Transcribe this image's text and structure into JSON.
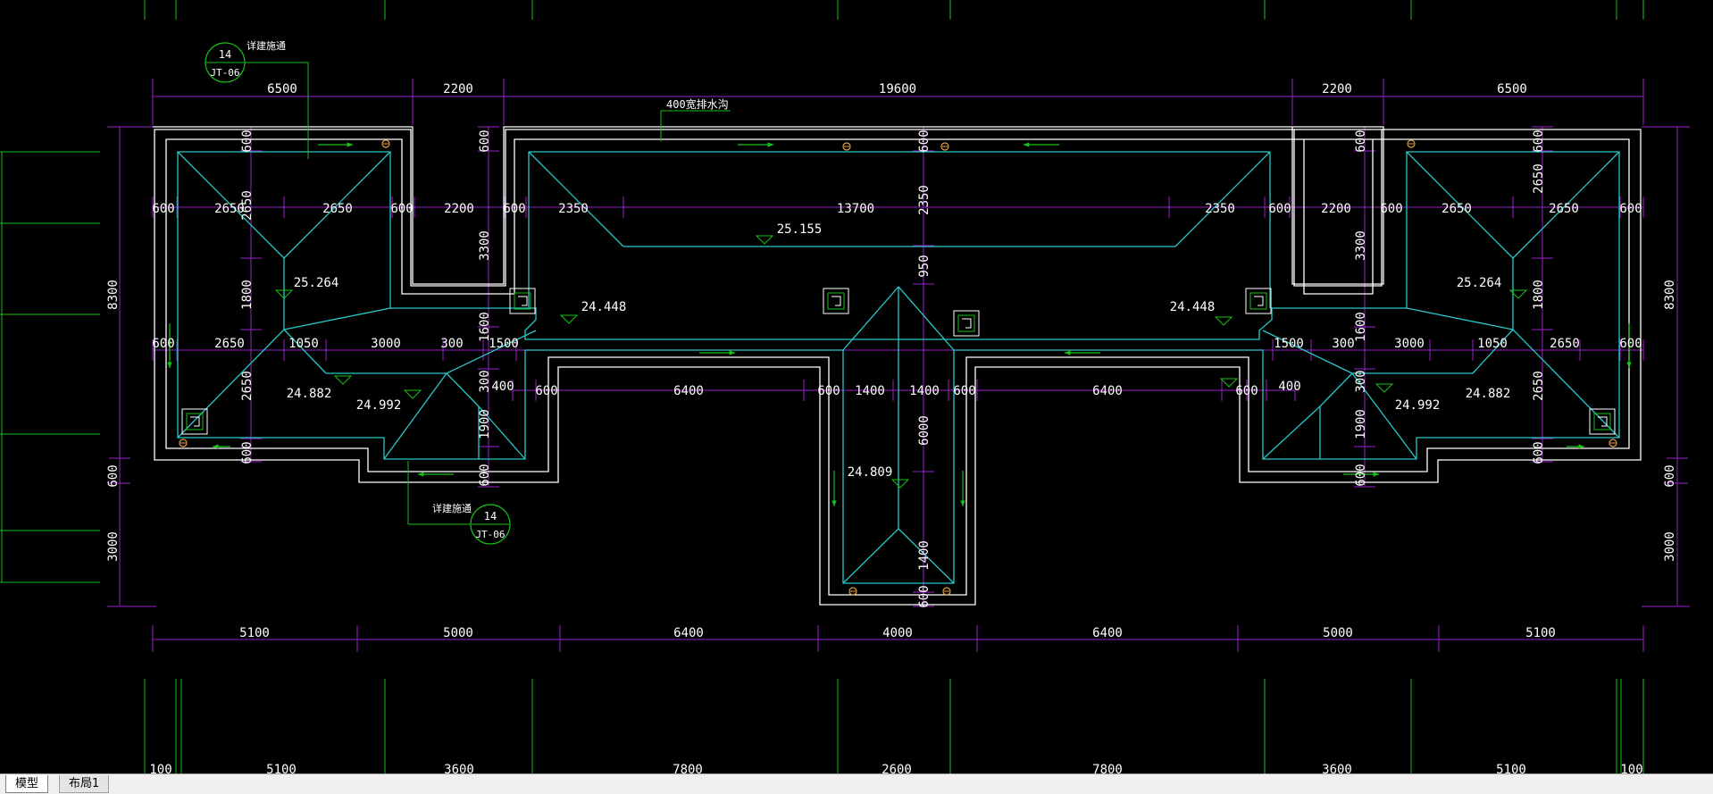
{
  "drawing": {
    "colors": {
      "background": "#000000",
      "dimension": "#9b1fc9",
      "ridge": "#28c8c8",
      "wall": "#ffffff",
      "grid": "#18c018",
      "text": "#ffffff",
      "tag": "#18c018"
    },
    "top_dims": [
      "6500",
      "2200",
      "19600",
      "2200",
      "6500"
    ],
    "bottom_dims": [
      "5100",
      "5000",
      "6400",
      "4000",
      "6400",
      "5000",
      "5100"
    ],
    "axis_dims": [
      "100",
      "5100",
      "3600",
      "7800",
      "2600",
      "7800",
      "3600",
      "5100",
      "100"
    ],
    "left_dims": [
      "8300",
      "600",
      "3000"
    ],
    "right_dims": [
      "8300",
      "600",
      "3000"
    ],
    "drain_label": "400宽排水沟",
    "detail_tags": [
      {
        "number": "14",
        "sheet": "JT-06",
        "note": "详建施通"
      },
      {
        "number": "14",
        "sheet": "JT-06",
        "note": "详建施通"
      }
    ],
    "elevations": {
      "center_ridge": "25.155",
      "left_top": "25.264",
      "right_top": "25.264",
      "left_mid": "24.448",
      "right_mid": "24.448",
      "left_low1": "24.882",
      "left_low2": "24.992",
      "right_low1": "24.992",
      "right_low2": "24.882",
      "south_wing": "24.809"
    },
    "inner_dims": {
      "r1": [
        "600",
        "2650",
        "2650",
        "600",
        "2200",
        "600",
        "2350",
        "13700",
        "2350",
        "600",
        "2200",
        "600",
        "2650",
        "2650",
        "600"
      ],
      "r2": [
        "600",
        "2650",
        "1050",
        "3000",
        "300",
        "1500",
        "1500",
        "300",
        "3000",
        "1050",
        "2650",
        "600"
      ],
      "r3": [
        "400",
        "600",
        "6400",
        "600",
        "1400",
        "1400",
        "600",
        "6400",
        "600",
        "400"
      ],
      "v_left": [
        "600",
        "2650",
        "1800",
        "2650",
        "600"
      ],
      "v_c1": [
        "600",
        "3300",
        "1600",
        "300",
        "1900",
        "600"
      ],
      "v_mid": [
        "600",
        "2350",
        "950",
        "6000",
        "1400",
        "600"
      ],
      "v_c2": [
        "600",
        "3300",
        "1600",
        "300",
        "1900",
        "600"
      ],
      "v_right": [
        "600",
        "2650",
        "1800",
        "2650",
        "600"
      ]
    }
  },
  "tabs": [
    {
      "label": "模型"
    },
    {
      "label": "布局1"
    }
  ]
}
